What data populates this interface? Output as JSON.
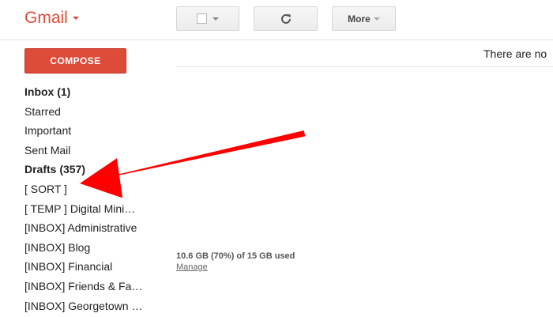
{
  "header": {
    "brand": "Gmail",
    "more_label": "More"
  },
  "compose_label": "COMPOSE",
  "nav": {
    "items": [
      {
        "label": "Inbox (1)",
        "bold": true
      },
      {
        "label": "Starred",
        "bold": false
      },
      {
        "label": "Important",
        "bold": false
      },
      {
        "label": "Sent Mail",
        "bold": false
      },
      {
        "label": "Drafts (357)",
        "bold": true
      },
      {
        "label": "[ SORT ]",
        "bold": false
      },
      {
        "label": "[ TEMP ] Digital Mini…",
        "bold": false
      },
      {
        "label": "[INBOX] Administrative",
        "bold": false
      },
      {
        "label": "[INBOX] Blog",
        "bold": false
      },
      {
        "label": "[INBOX] Financial",
        "bold": false
      },
      {
        "label": "[INBOX] Friends & Fa…",
        "bold": false
      },
      {
        "label": "[INBOX] Georgetown …",
        "bold": false
      }
    ]
  },
  "main": {
    "notice": "There are no"
  },
  "storage": {
    "used_text": "10.6 GB (70%) of 15 GB used",
    "used_fraction": 0.7,
    "manage_label": "Manage"
  },
  "annotation": {
    "color": "#ff0000"
  },
  "colors": {
    "brand": "#dd4b39",
    "compose_bg": "#dd4b39"
  },
  "icons": {
    "refresh": "refresh-icon",
    "select_checkbox": "checkbox-icon",
    "dropdown": "chevron-down-icon"
  }
}
